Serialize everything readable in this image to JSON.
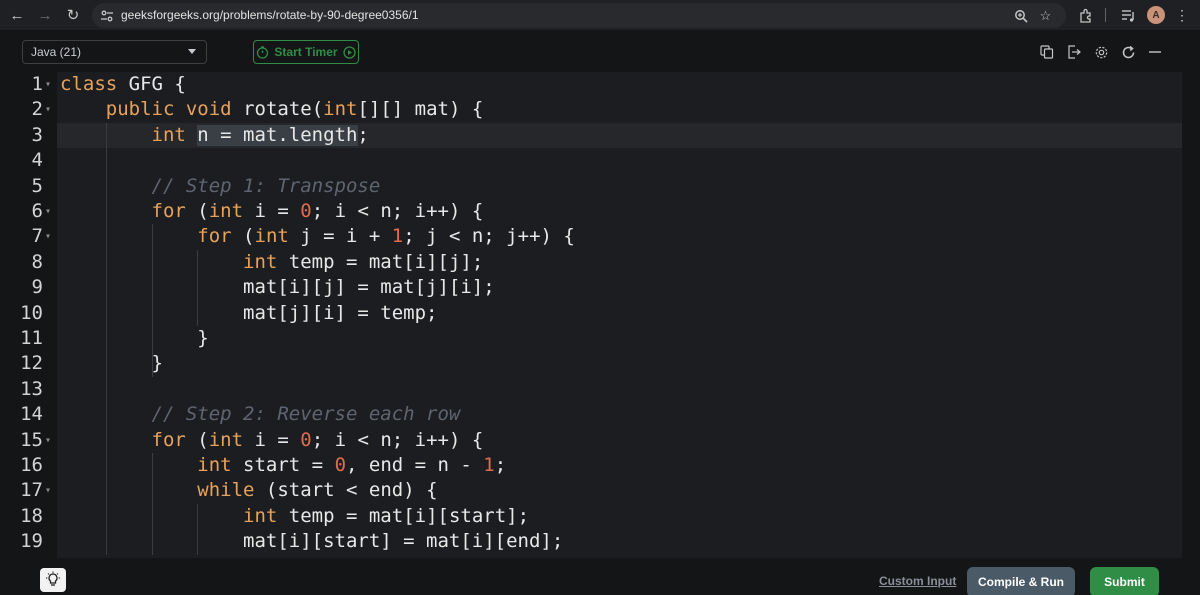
{
  "browser": {
    "url": "geeksforgeeks.org/problems/rotate-by-90-degree0356/1",
    "avatar_initial": "A"
  },
  "toolbar": {
    "language": "Java (21)",
    "timer_label": "Start Timer"
  },
  "editor": {
    "lines": [
      {
        "n": "1",
        "fold": true
      },
      {
        "n": "2",
        "fold": true
      },
      {
        "n": "3",
        "fold": false
      },
      {
        "n": "4",
        "fold": false
      },
      {
        "n": "5",
        "fold": false
      },
      {
        "n": "6",
        "fold": true
      },
      {
        "n": "7",
        "fold": true
      },
      {
        "n": "8",
        "fold": false
      },
      {
        "n": "9",
        "fold": false
      },
      {
        "n": "10",
        "fold": false
      },
      {
        "n": "11",
        "fold": false
      },
      {
        "n": "12",
        "fold": false
      },
      {
        "n": "13",
        "fold": false
      },
      {
        "n": "14",
        "fold": false
      },
      {
        "n": "15",
        "fold": true
      },
      {
        "n": "16",
        "fold": false
      },
      {
        "n": "17",
        "fold": true
      },
      {
        "n": "18",
        "fold": false
      },
      {
        "n": "19",
        "fold": false
      }
    ],
    "code": [
      [
        {
          "t": "kw",
          "v": "class"
        },
        {
          "t": "",
          "v": " GFG {"
        }
      ],
      [
        {
          "t": "",
          "v": "    "
        },
        {
          "t": "kw",
          "v": "public"
        },
        {
          "t": "",
          "v": " "
        },
        {
          "t": "kw",
          "v": "void"
        },
        {
          "t": "",
          "v": " rotate("
        },
        {
          "t": "kw",
          "v": "int"
        },
        {
          "t": "",
          "v": "[][] mat) {"
        }
      ],
      [
        {
          "t": "",
          "v": "        "
        },
        {
          "t": "kw",
          "v": "int"
        },
        {
          "t": "",
          "v": " n = mat.length;"
        }
      ],
      [
        {
          "t": "",
          "v": ""
        }
      ],
      [
        {
          "t": "",
          "v": "        "
        },
        {
          "t": "cm",
          "v": "// Step 1: Transpose"
        }
      ],
      [
        {
          "t": "",
          "v": "        "
        },
        {
          "t": "kw",
          "v": "for"
        },
        {
          "t": "",
          "v": " ("
        },
        {
          "t": "kw",
          "v": "int"
        },
        {
          "t": "",
          "v": " i = "
        },
        {
          "t": "num",
          "v": "0"
        },
        {
          "t": "",
          "v": "; i < n; i++) {"
        }
      ],
      [
        {
          "t": "",
          "v": "            "
        },
        {
          "t": "kw",
          "v": "for"
        },
        {
          "t": "",
          "v": " ("
        },
        {
          "t": "kw",
          "v": "int"
        },
        {
          "t": "",
          "v": " j = i + "
        },
        {
          "t": "num",
          "v": "1"
        },
        {
          "t": "",
          "v": "; j < n; j++) {"
        }
      ],
      [
        {
          "t": "",
          "v": "                "
        },
        {
          "t": "kw",
          "v": "int"
        },
        {
          "t": "",
          "v": " temp = mat[i][j];"
        }
      ],
      [
        {
          "t": "",
          "v": "                mat[i][j] = mat[j][i];"
        }
      ],
      [
        {
          "t": "",
          "v": "                mat[j][i] = temp;"
        }
      ],
      [
        {
          "t": "",
          "v": "            }"
        }
      ],
      [
        {
          "t": "",
          "v": "        }"
        }
      ],
      [
        {
          "t": "",
          "v": ""
        }
      ],
      [
        {
          "t": "",
          "v": "        "
        },
        {
          "t": "cm",
          "v": "// Step 2: Reverse each row"
        }
      ],
      [
        {
          "t": "",
          "v": "        "
        },
        {
          "t": "kw",
          "v": "for"
        },
        {
          "t": "",
          "v": " ("
        },
        {
          "t": "kw",
          "v": "int"
        },
        {
          "t": "",
          "v": " i = "
        },
        {
          "t": "num",
          "v": "0"
        },
        {
          "t": "",
          "v": "; i < n; i++) {"
        }
      ],
      [
        {
          "t": "",
          "v": "            "
        },
        {
          "t": "kw",
          "v": "int"
        },
        {
          "t": "",
          "v": " start = "
        },
        {
          "t": "num",
          "v": "0"
        },
        {
          "t": "",
          "v": ", end = n - "
        },
        {
          "t": "num",
          "v": "1"
        },
        {
          "t": "",
          "v": ";"
        }
      ],
      [
        {
          "t": "",
          "v": "            "
        },
        {
          "t": "kw",
          "v": "while"
        },
        {
          "t": "",
          "v": " (start < end) {"
        }
      ],
      [
        {
          "t": "",
          "v": "                "
        },
        {
          "t": "kw",
          "v": "int"
        },
        {
          "t": "",
          "v": " temp = mat[i][start];"
        }
      ],
      [
        {
          "t": "",
          "v": "                mat[i][start] = mat[i][end];"
        }
      ]
    ]
  },
  "bottom": {
    "custom_input_label": "Custom Input",
    "compile_label": "Compile & Run",
    "submit_label": "Submit"
  },
  "colors": {
    "accent_green": "#2f8d46",
    "keyword": "#e8a25b",
    "number": "#e06c4a",
    "comment": "#5f6570"
  }
}
